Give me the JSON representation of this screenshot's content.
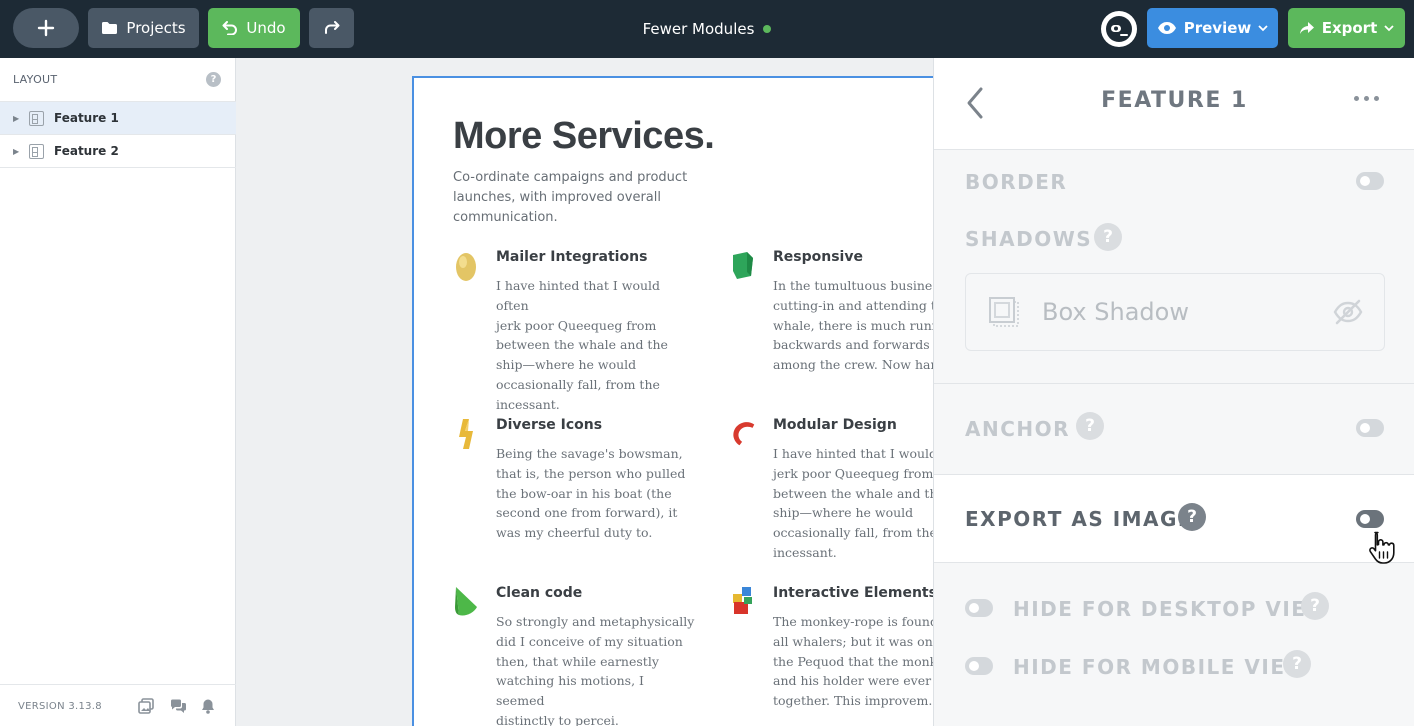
{
  "topbar": {
    "add_icon": "plus-icon",
    "projects_label": "Projects",
    "undo_label": "Undo",
    "project_name": "Fewer Modules",
    "status_color": "#5cb85c",
    "preview_label": "Preview",
    "export_label": "Export"
  },
  "layout_panel": {
    "title": "LAYOUT",
    "help": "?",
    "layers": [
      {
        "label": "Feature 1",
        "selected": true
      },
      {
        "label": "Feature 2",
        "selected": false
      }
    ],
    "version": "VERSION 3.13.8"
  },
  "canvas": {
    "title": "More Services.",
    "subtitle": "Co-ordinate campaigns and product launches, with improved overall communication.",
    "features": [
      {
        "title": "Mailer Integrations",
        "desc": "I have hinted that I would often\njerk poor Queequeg from\nbetween the whale and the\nship—where he would\noccasionally fall, from the\nincessant.",
        "icon": "egg-icon"
      },
      {
        "title": "Responsive",
        "desc": "In the tumultuous business of\ncutting-in and attending to a\nwhale, there is much running\nbackwards and forwards\namong the crew. Now hands",
        "icon": "green-cube-icon"
      },
      {
        "title": "Diverse Icons",
        "desc": "Being the savage's bowsman,\nthat is, the person who pulled\nthe bow-oar in his boat (the\nsecond one from forward), it\nwas my cheerful duty to.",
        "icon": "lightning-icon"
      },
      {
        "title": "Modular Design",
        "desc": "I have hinted that I would\njerk poor Queequeg from\nbetween the whale and the\nship—where he would\noccasionally fall, from the\nincessant.",
        "icon": "red-curve-icon"
      },
      {
        "title": "Clean code",
        "desc": "So strongly and metaphysically\ndid I conceive of my situation\nthen, that while earnestly\nwatching his motions, I seemed\ndistinctly to percei.",
        "icon": "green-cone-icon"
      },
      {
        "title": "Interactive Elements",
        "desc": "The monkey-rope is found in\nall whalers; but it was only in\nthe Pequod that the monkey\nand his holder were ever tied\ntogether. This improvem.",
        "icon": "stacked-blocks-icon"
      }
    ]
  },
  "properties_panel": {
    "title": "FEATURE 1",
    "border_label": "BORDER",
    "shadows_label": "SHADOWS",
    "box_shadow_label": "Box Shadow",
    "anchor_label": "ANCHOR",
    "export_as_image_label": "EXPORT AS IMAGE",
    "hide_desktop_label": "HIDE FOR DESKTOP VIEW",
    "hide_mobile_label": "HIDE FOR MOBILE VIEW",
    "help": "?"
  }
}
